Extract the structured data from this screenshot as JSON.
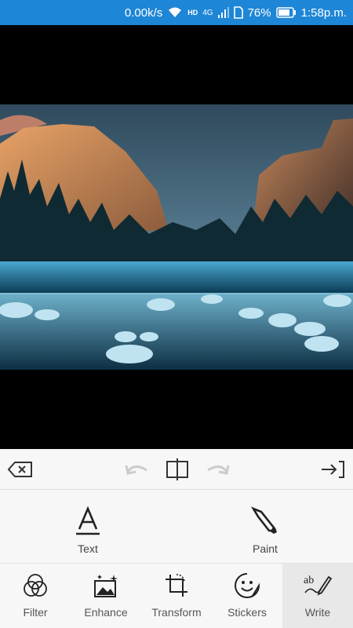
{
  "status_bar": {
    "network_speed": "0.00k/s",
    "battery_percent": "76%",
    "time": "1:58p.m.",
    "network_type": "4G",
    "background_color": "#1e86d6"
  },
  "photo": {
    "subject": "snowy valley river with granite cliffs"
  },
  "toolbar": {
    "delete_icon": "backspace-icon",
    "undo_icon": "undo-icon",
    "compare_icon": "compare-icon",
    "redo_icon": "redo-icon",
    "apply_icon": "apply-icon"
  },
  "tools": [
    {
      "label": "Text",
      "icon": "text-icon"
    },
    {
      "label": "Paint",
      "icon": "brush-icon"
    }
  ],
  "tabs": [
    {
      "label": "Filter",
      "icon": "filter-icon"
    },
    {
      "label": "Enhance",
      "icon": "enhance-icon"
    },
    {
      "label": "Transform",
      "icon": "crop-icon"
    },
    {
      "label": "Stickers",
      "icon": "sticker-icon"
    },
    {
      "label": "Write",
      "icon": "write-icon",
      "active": true
    }
  ]
}
